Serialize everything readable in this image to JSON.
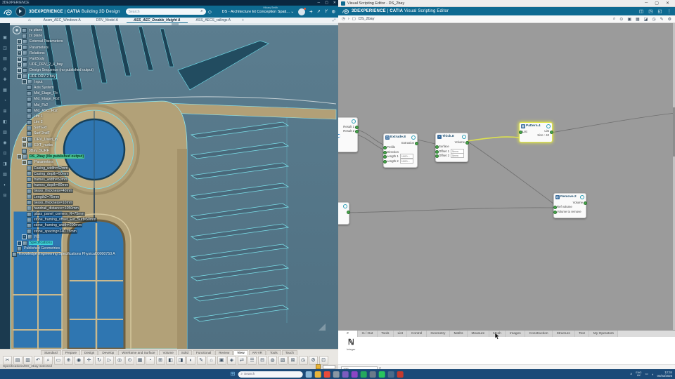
{
  "left_window": {
    "titlebar": {
      "title": "3DEXPERIENCE",
      "min": "─",
      "max": "▢",
      "close": "✕"
    },
    "header": {
      "brand": "3DEXPERIENCE",
      "sep": "|",
      "app": "CATIA",
      "app_suffix": "Building 3D Design",
      "search_placeholder": "Search",
      "user": "Hilcary Smith",
      "workspace": "DS - Architecture Et Conception Spati...",
      "workspace_caret": "⌄",
      "icons": {
        "search": "⌕",
        "tag": "◇",
        "plus": "+",
        "share": "↗",
        "compass": "Y",
        "globe": "◍"
      }
    },
    "tabs": [
      {
        "label": "Assm_AEC_Windows A"
      },
      {
        "label": "DRV_Model A"
      },
      {
        "label": "ASS_AEC_Double_Height A",
        "hl": "active"
      },
      {
        "label": "ASS_AECS_railings A"
      }
    ],
    "tab_bar": {
      "home": "⌂",
      "add": "+",
      "expand": "⤢"
    },
    "side_tools": [
      {
        "n": "side-tool-icon",
        "g": "▣"
      },
      {
        "n": "side-tool-icon",
        "g": "◳"
      },
      {
        "n": "side-tool-icon",
        "g": "▤"
      },
      {
        "n": "side-tool-icon",
        "g": "◍"
      },
      {
        "n": "side-tool-icon",
        "g": "✚"
      },
      {
        "n": "side-tool-icon",
        "g": "▦"
      },
      {
        "n": "side-tool-icon",
        "g": "◔"
      },
      {
        "n": "side-tool-icon",
        "g": "⊞"
      },
      {
        "n": "side-tool-icon",
        "g": "◧"
      },
      {
        "n": "side-tool-icon",
        "g": "▥"
      },
      {
        "n": "side-tool-icon",
        "g": "◉"
      },
      {
        "n": "side-tool-icon",
        "g": "⊡"
      },
      {
        "n": "side-tool-icon",
        "g": "◨"
      },
      {
        "n": "side-tool-icon",
        "g": "▧"
      },
      {
        "n": "side-tool-icon",
        "g": "◐"
      },
      {
        "n": "side-tool-icon",
        "g": "⊟"
      }
    ],
    "tree": {
      "items": [
        {
          "i": 2,
          "exp": "",
          "label": "yz plane",
          "hl": ""
        },
        {
          "i": 2,
          "exp": "",
          "label": "zx plane",
          "hl": ""
        },
        {
          "i": 1,
          "exp": "+",
          "label": "External Parameters",
          "hl": ""
        },
        {
          "i": 1,
          "exp": "+",
          "label": "Parameters",
          "hl": ""
        },
        {
          "i": 1,
          "exp": "+",
          "label": "Relations",
          "hl": ""
        },
        {
          "i": 1,
          "exp": "+",
          "label": "PartBody",
          "hl": ""
        },
        {
          "i": 1,
          "exp": "+",
          "label": "UDF_DRV_2_4_bay",
          "hl": ""
        },
        {
          "i": 1,
          "exp": "+",
          "label": "Design Sequence (no published output)",
          "hl": ""
        },
        {
          "i": 1,
          "exp": "-",
          "label": "UDF DRV 2 bay",
          "hl": "box"
        },
        {
          "i": 2,
          "exp": "-",
          "label": "Input",
          "hl": ""
        },
        {
          "i": 3,
          "exp": "",
          "label": "Axis System",
          "hl": ""
        },
        {
          "i": 3,
          "exp": "",
          "label": "Mid_Etage_Fb",
          "hl": ""
        },
        {
          "i": 3,
          "exp": "",
          "label": "Mid_Etage_Fb2",
          "hl": ""
        },
        {
          "i": 3,
          "exp": "",
          "label": "Mid_Fb2",
          "hl": ""
        },
        {
          "i": 3,
          "exp": "",
          "label": "Mid_ASC_Fb2",
          "hl": ""
        },
        {
          "i": 3,
          "exp": "",
          "label": "Lim 1",
          "hl": ""
        },
        {
          "i": 3,
          "exp": "",
          "label": "Lim 2",
          "hl": ""
        },
        {
          "i": 3,
          "exp": "",
          "label": "Surf Ext",
          "hl": ""
        },
        {
          "i": 3,
          "exp": "",
          "label": "Surf 2ndF",
          "hl": ""
        },
        {
          "i": 2,
          "exp": "+",
          "label": "DRV_Used_in",
          "hl": ""
        },
        {
          "i": 2,
          "exp": "+",
          "label": "EXT_nurbs",
          "hl": ""
        },
        {
          "i": 2,
          "exp": "",
          "label": "3Bay_SURF",
          "hl": ""
        },
        {
          "i": 1,
          "exp": "-",
          "label": "DS_2bay (No published output)",
          "hl": "green"
        },
        {
          "i": 2,
          "exp": "-",
          "label": "Parameters",
          "hl": ""
        },
        {
          "i": 3,
          "exp": "",
          "label": "Casing_width=62mm",
          "hl": "chip"
        },
        {
          "i": 3,
          "exp": "",
          "label": "Casing_depth=50mm",
          "hl": "chip"
        },
        {
          "i": 3,
          "exp": "",
          "label": "frames_width=50mm",
          "hl": "chip"
        },
        {
          "i": 3,
          "exp": "",
          "label": "frames_depth=80mm",
          "hl": "chip"
        },
        {
          "i": 3,
          "exp": "",
          "label": "Glass_thickness=40mm",
          "hl": "chip"
        },
        {
          "i": 3,
          "exp": "",
          "label": "Length2=75mm",
          "hl": "chip"
        },
        {
          "i": 3,
          "exp": "",
          "label": "Glass_thickness=10mm",
          "hl": "chip"
        },
        {
          "i": 3,
          "exp": "",
          "label": "handrail_distance=1050mm",
          "hl": "chip"
        },
        {
          "i": 3,
          "exp": "",
          "label": "glass_panel_corners_R=75mm",
          "hl": "chip"
        },
        {
          "i": 3,
          "exp": "",
          "label": "stone_framing_offset_Ext_Surf=50mm",
          "hl": "chip"
        },
        {
          "i": 3,
          "exp": "",
          "label": "stone_framing_width=200mm",
          "hl": "chip"
        },
        {
          "i": 3,
          "exp": "",
          "label": "stone_spacing=240.75mm",
          "hl": "chip"
        },
        {
          "i": 2,
          "exp": "+",
          "label": "Fill",
          "hl": ""
        },
        {
          "i": 1,
          "exp": "-",
          "label": "Specifications",
          "hl": "cyan"
        },
        {
          "i": 1,
          "exp": "",
          "label": "Published Geometries",
          "hl": ""
        },
        {
          "i": 0,
          "exp": "",
          "label": "Knowledge Engineering Specifications Physical00000750 A",
          "hl": ""
        }
      ]
    },
    "action_bar": {
      "tabs": [
        {
          "label": "Standard"
        },
        {
          "label": "Prepare"
        },
        {
          "label": "Design"
        },
        {
          "label": "Develop"
        },
        {
          "label": "Wireframe and Surface"
        },
        {
          "label": "Volume"
        },
        {
          "label": "Solid"
        },
        {
          "label": "Functional"
        },
        {
          "label": "Review"
        },
        {
          "label": "View",
          "hl": "active"
        },
        {
          "label": "AR-VR"
        },
        {
          "label": "Tools"
        },
        {
          "label": "Touch"
        }
      ],
      "icons": [
        {
          "n": "cut-icon",
          "g": "✂"
        },
        {
          "n": "copy-icon",
          "g": "▤"
        },
        {
          "n": "paste-icon",
          "g": "▥"
        },
        {
          "n": "undo-icon",
          "g": "↶"
        },
        {
          "n": "zoom-icon",
          "g": "⌕"
        },
        {
          "n": "select-frame-icon",
          "g": "▭"
        },
        {
          "n": "update-icon",
          "g": "⊕"
        },
        {
          "n": "explore-icon",
          "g": "◉"
        },
        {
          "n": "pan-icon",
          "g": "✛"
        },
        {
          "n": "rotate-icon",
          "g": "↻"
        },
        {
          "n": "fly-icon",
          "g": "▷"
        },
        {
          "n": "look-at-icon",
          "g": "◎"
        },
        {
          "n": "render-style-icon",
          "g": "⊙"
        },
        {
          "n": "wireframe-icon",
          "g": "▦"
        },
        {
          "n": "hide-show-icon",
          "g": "◔"
        },
        {
          "n": "grid-icon",
          "g": "⊞"
        },
        {
          "n": "section-icon",
          "g": "◧"
        },
        {
          "n": "clip-icon",
          "g": "◨"
        },
        {
          "n": "light-icon",
          "g": "◐"
        },
        {
          "n": "sketch-icon",
          "g": "✎"
        },
        {
          "n": "home-view-icon",
          "g": "⌂"
        },
        {
          "n": "tag-icon",
          "g": "▣"
        },
        {
          "n": "material-icon",
          "g": "◈"
        },
        {
          "n": "swap-icon",
          "g": "⇄"
        },
        {
          "n": "menu-icon",
          "g": "☰"
        },
        {
          "n": "collapse-icon",
          "g": "⊟"
        },
        {
          "n": "sphere-icon",
          "g": "◍"
        },
        {
          "n": "hatch-icon",
          "g": "▧"
        },
        {
          "n": "close-icon",
          "g": "⊠"
        },
        {
          "n": "history-icon",
          "g": "◷"
        },
        {
          "n": "settings-icon",
          "g": "⚙"
        },
        {
          "n": "filter-icon",
          "g": "⊡"
        }
      ]
    },
    "status": {
      "text": "Specifications/DS_2bay selected"
    }
  },
  "right_window": {
    "titlebar": {
      "title": "Visual Scripting Editor - DS_2bay",
      "min": "─",
      "max": "▢",
      "close": "✕"
    },
    "header": {
      "brand": "3DEXPERIENCE",
      "sep": "|",
      "app": "CATIA",
      "app_suffix": "Visual Scripting Editor",
      "icons": [
        {
          "n": "columns-icon",
          "g": "◫"
        },
        {
          "n": "windows-icon",
          "g": "◳"
        },
        {
          "n": "resize-icon",
          "g": "◱"
        },
        {
          "n": "kebab-icon",
          "g": "⋮"
        }
      ]
    },
    "toolbar": {
      "history": "◷",
      "chevron": "›",
      "node_glyph": "▢",
      "breadcrumb": "DS_2bay",
      "icons": [
        {
          "n": "zoom-icon",
          "g": "⌕"
        },
        {
          "n": "find-icon",
          "g": "⊙"
        },
        {
          "n": "tag-icon",
          "g": "▣"
        },
        {
          "n": "image-icon",
          "g": "▦"
        },
        {
          "n": "flag-icon",
          "g": "◪"
        },
        {
          "n": "history-icon",
          "g": "◷"
        },
        {
          "n": "edit-icon",
          "g": "✎"
        },
        {
          "n": "settings-icon",
          "g": "⚙"
        }
      ]
    },
    "graph": {
      "result_node": {
        "outputs": [
          "Result 1",
          "Result 2"
        ]
      },
      "extrude": {
        "title": "Extrude.8",
        "icon": "◳",
        "output": "Extrusion",
        "inputs": [
          {
            "label": "Profile"
          },
          {
            "label": "Direction"
          },
          {
            "label": "Length 1",
            "value": "1000..."
          },
          {
            "label": "Length 2",
            "value": "1000..."
          }
        ]
      },
      "thick": {
        "title": "Thick.8",
        "icon": "◔",
        "output": "Volume",
        "inputs": [
          {
            "label": "Surface"
          },
          {
            "label": "Offset 1",
            "value": "5mm"
          },
          {
            "label": "Offset 2",
            "value": "5mm"
          }
        ]
      },
      "pattern": {
        "title": "Pattern.4",
        "icon": "▦",
        "input": "List",
        "outputs": [
          {
            "label": "List",
            "dot": 1
          },
          {
            "label": "Size : 40",
            "dot": 0
          }
        ]
      },
      "remove": {
        "title": "Remove.2",
        "icon": "◍",
        "output": "Volume",
        "inputs": [
          {
            "label": "Ref volume"
          },
          {
            "label": "Volume to remove"
          }
        ]
      }
    },
    "palette": {
      "search_tab": "⌕",
      "tabs": [
        {
          "label": "In / Out"
        },
        {
          "label": "Tools"
        },
        {
          "label": "List"
        },
        {
          "label": "Control"
        },
        {
          "label": "Geometry"
        },
        {
          "label": "Maths"
        },
        {
          "label": "Measure"
        },
        {
          "label": "Mesh"
        },
        {
          "label": "Images"
        },
        {
          "label": "Construction"
        },
        {
          "label": "Structure"
        },
        {
          "label": "Text"
        },
        {
          "label": "My Operators"
        }
      ],
      "item": {
        "glyph": "ℕ",
        "label": "Integer"
      },
      "search_value": "100",
      "search_glyph": "⌕"
    }
  },
  "taskbar": {
    "start": "⊞",
    "search_placeholder": "Search",
    "search_glyph": "⌕",
    "apps": [
      {
        "n": "taskview-icon",
        "c": "#8ab6d6"
      },
      {
        "n": "explorer-icon",
        "c": "#e8b43a"
      },
      {
        "n": "chrome-icon",
        "c": "#e84a3a"
      },
      {
        "n": "app-gray-icon",
        "c": "#8a97a3"
      },
      {
        "n": "app-purple-icon",
        "c": "#7b5cbf"
      },
      {
        "n": "media-icon",
        "c": "#8a46c4"
      },
      {
        "n": "spotify-icon",
        "c": "#24a85e"
      },
      {
        "n": "phone-icon",
        "c": "#6a7b8a"
      },
      {
        "n": "whatsapp-icon",
        "c": "#28c45e"
      },
      {
        "n": "settings-icon",
        "c": "#4a6b8a"
      },
      {
        "n": "app-red-icon",
        "c": "#c43a2e"
      }
    ],
    "tray": {
      "chevron": "∧",
      "lang1": "ENG",
      "lang2": "UK",
      "display": "▭",
      "volume": "◖",
      "time": "12:34",
      "date": "04/03/2026"
    }
  }
}
